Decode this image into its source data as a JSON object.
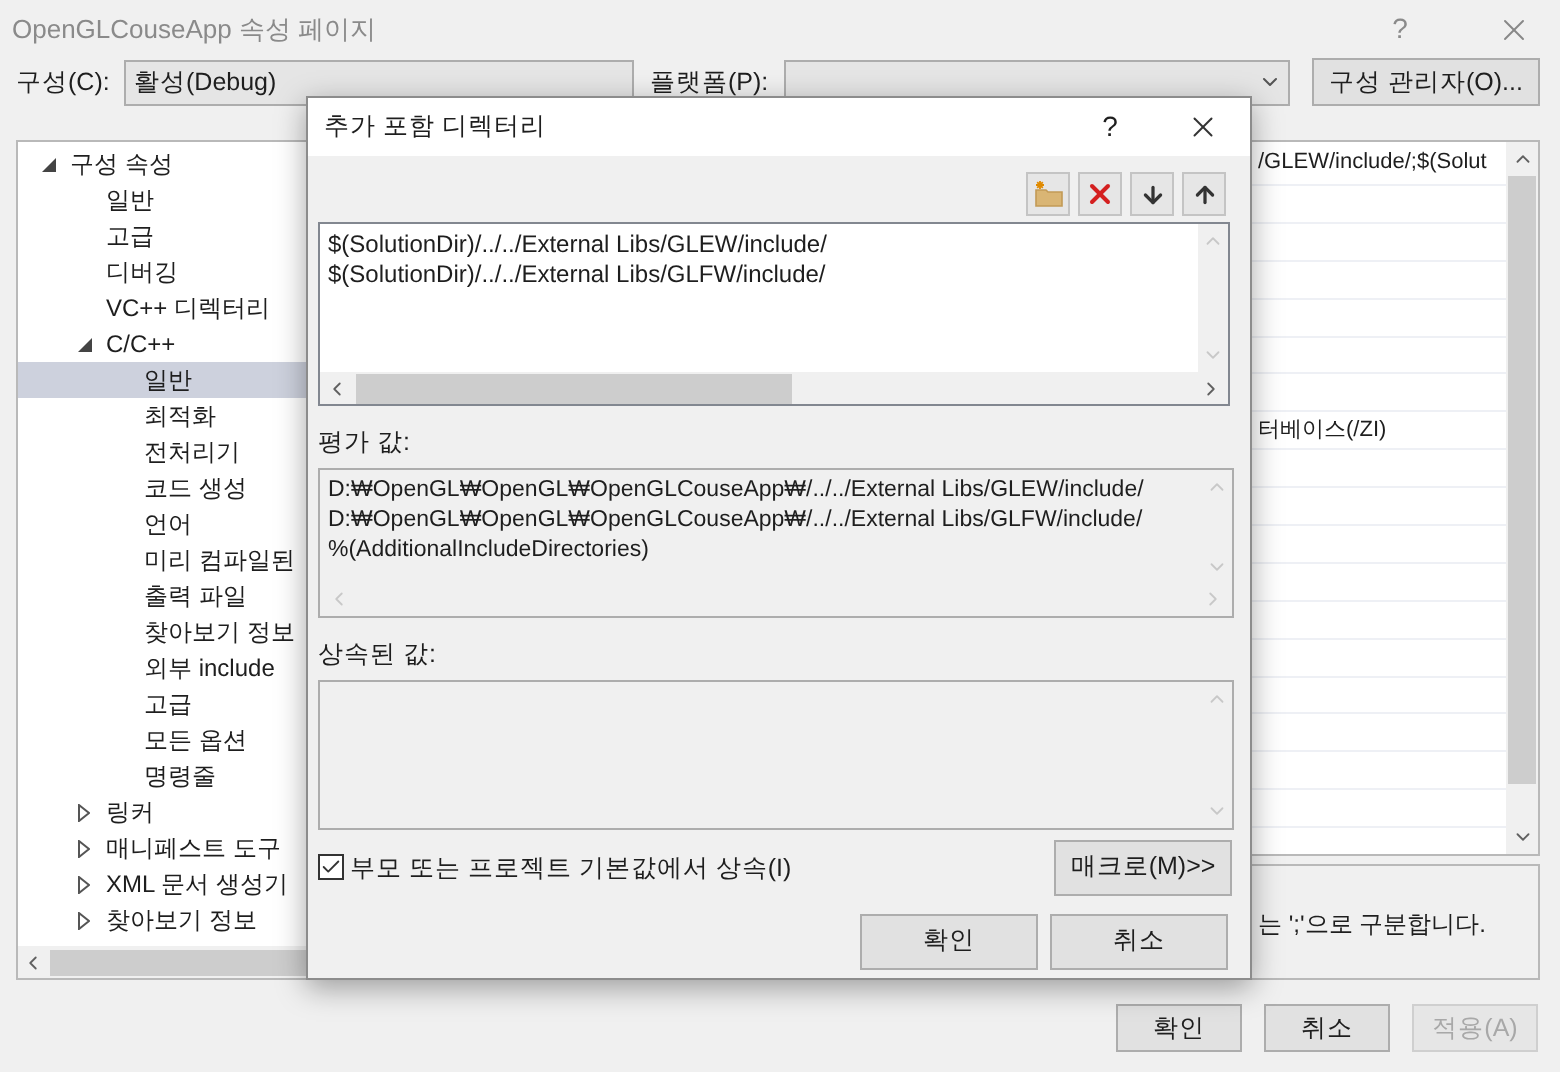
{
  "window": {
    "title": "OpenGLCouseApp 속성 페이지",
    "help": "?"
  },
  "config": {
    "label": "구성(C):",
    "value": "활성(Debug)"
  },
  "platform": {
    "label": "플랫폼(P):"
  },
  "config_manager": "구성 관리자(O)...",
  "tree": [
    {
      "label": "구성 속성",
      "expanded": true,
      "selected": false,
      "children": [
        {
          "label": "일반",
          "selected": false
        },
        {
          "label": "고급",
          "selected": false
        },
        {
          "label": "디버깅",
          "selected": false
        },
        {
          "label": "VC++ 디렉터리",
          "selected": false
        },
        {
          "label": "C/C++",
          "expanded": true,
          "selected": false,
          "children": [
            {
              "label": "일반",
              "selected": true
            },
            {
              "label": "최적화",
              "selected": false
            },
            {
              "label": "전처리기",
              "selected": false
            },
            {
              "label": "코드 생성",
              "selected": false
            },
            {
              "label": "언어",
              "selected": false
            },
            {
              "label": "미리 컴파일된",
              "selected": false
            },
            {
              "label": "출력 파일",
              "selected": false
            },
            {
              "label": "찾아보기 정보",
              "selected": false
            },
            {
              "label": "외부 include",
              "selected": false
            },
            {
              "label": "고급",
              "selected": false
            },
            {
              "label": "모든 옵션",
              "selected": false
            },
            {
              "label": "명령줄",
              "selected": false
            }
          ]
        },
        {
          "label": "링커",
          "expanded": false,
          "selected": false
        },
        {
          "label": "매니페스트 도구",
          "expanded": false,
          "selected": false
        },
        {
          "label": "XML 문서 생성기",
          "expanded": false,
          "selected": false
        },
        {
          "label": "찾아보기 정보",
          "expanded": false,
          "selected": false
        }
      ]
    }
  ],
  "property_grid": {
    "rows": [
      {
        "value": "/GLEW/include/;$(Solut"
      },
      {},
      {},
      {},
      {},
      {},
      {},
      {
        "value": "터베이스(/ZI)"
      },
      {},
      {},
      {},
      {},
      {},
      {},
      {},
      {},
      {},
      {}
    ]
  },
  "description": "는 ';'으로 구분합니다.",
  "buttons": [
    {
      "label": "확인",
      "disabled": false
    },
    {
      "label": "취소",
      "disabled": false
    },
    {
      "label": "적용(A)",
      "disabled": true
    }
  ],
  "dialog": {
    "title": "추가 포함 디렉터리",
    "help": "?",
    "directories": [
      "$(SolutionDir)/../../External Libs/GLEW/include/",
      "$(SolutionDir)/../../External Libs/GLFW/include/"
    ],
    "evaluated_label": "평가 값:",
    "evaluated": [
      "D:₩OpenGL₩OpenGL₩OpenGLCouseApp₩/../../External Libs/GLEW/include/",
      "D:₩OpenGL₩OpenGL₩OpenGLCouseApp₩/../../External Libs/GLFW/include/",
      "%(AdditionalIncludeDirectories)"
    ],
    "inherited_label": "상속된 값:",
    "inherit": {
      "label": "부모 또는 프로젝트 기본값에서 상속(I)",
      "checked": true
    },
    "macros_button": "매크로(M)>>",
    "buttons": [
      "확인",
      "취소"
    ]
  }
}
